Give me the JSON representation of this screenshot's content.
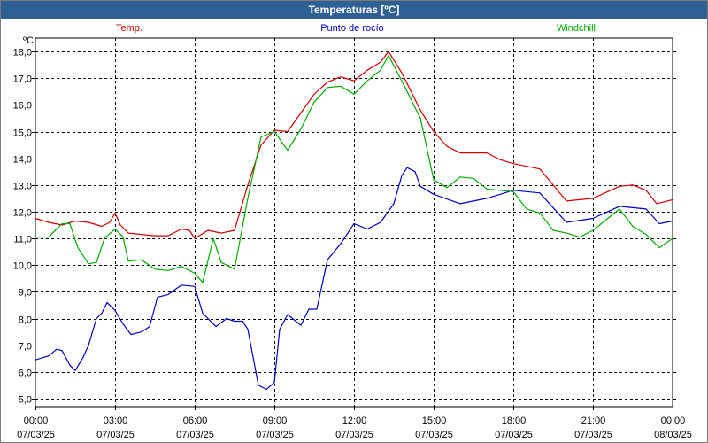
{
  "window": {
    "title": "Temperaturas [ºC]"
  },
  "chart_data": {
    "type": "line",
    "ylabel": "ºC",
    "ylim": [
      4.7,
      18.5
    ],
    "yticks": [
      "5,0",
      "6,0",
      "7,0",
      "8,0",
      "9,0",
      "10,0",
      "11,0",
      "12,0",
      "13,0",
      "14,0",
      "15,0",
      "16,0",
      "17,0",
      "18,0"
    ],
    "ytick_values": [
      5,
      6,
      7,
      8,
      9,
      10,
      11,
      12,
      13,
      14,
      15,
      16,
      17,
      18
    ],
    "xlim": [
      0,
      24
    ],
    "xticks": [
      {
        "x": 0,
        "time": "00:00",
        "date": "07/03/25"
      },
      {
        "x": 3,
        "time": "03:00",
        "date": "07/03/25"
      },
      {
        "x": 6,
        "time": "06:00",
        "date": "07/03/25"
      },
      {
        "x": 9,
        "time": "09:00",
        "date": "07/03/25"
      },
      {
        "x": 12,
        "time": "12:00",
        "date": "07/03/25"
      },
      {
        "x": 15,
        "time": "15:00",
        "date": "07/03/25"
      },
      {
        "x": 18,
        "time": "18:00",
        "date": "07/03/25"
      },
      {
        "x": 21,
        "time": "21:00",
        "date": "07/03/25"
      },
      {
        "x": 24,
        "time": "00:00",
        "date": "08/03/25"
      }
    ],
    "grid": true,
    "legend_position": "top",
    "series": [
      {
        "name": "Temp.",
        "color": "#cc0000",
        "points": [
          [
            0,
            11.75
          ],
          [
            0.5,
            11.6
          ],
          [
            1,
            11.5
          ],
          [
            1.5,
            11.65
          ],
          [
            2,
            11.6
          ],
          [
            2.5,
            11.45
          ],
          [
            2.8,
            11.6
          ],
          [
            3,
            11.95
          ],
          [
            3.2,
            11.5
          ],
          [
            3.5,
            11.2
          ],
          [
            4,
            11.15
          ],
          [
            4.5,
            11.1
          ],
          [
            5,
            11.1
          ],
          [
            5.5,
            11.35
          ],
          [
            5.8,
            11.3
          ],
          [
            6,
            11.0
          ],
          [
            6.5,
            11.3
          ],
          [
            7,
            11.2
          ],
          [
            7.5,
            11.3
          ],
          [
            8,
            13.0
          ],
          [
            8.5,
            14.5
          ],
          [
            9,
            15.05
          ],
          [
            9.5,
            15.0
          ],
          [
            10,
            15.7
          ],
          [
            10.5,
            16.4
          ],
          [
            11,
            16.85
          ],
          [
            11.5,
            17.05
          ],
          [
            12,
            16.9
          ],
          [
            12.5,
            17.3
          ],
          [
            13,
            17.6
          ],
          [
            13.3,
            18.0
          ],
          [
            13.8,
            17.2
          ],
          [
            14.5,
            15.8
          ],
          [
            15,
            15.0
          ],
          [
            15.5,
            14.45
          ],
          [
            16,
            14.2
          ],
          [
            17,
            14.2
          ],
          [
            17.5,
            13.95
          ],
          [
            18,
            13.8
          ],
          [
            19,
            13.6
          ],
          [
            19.5,
            13.0
          ],
          [
            20,
            12.4
          ],
          [
            21,
            12.5
          ],
          [
            22,
            12.95
          ],
          [
            22.5,
            13.0
          ],
          [
            23,
            12.8
          ],
          [
            23.4,
            12.3
          ],
          [
            24,
            12.45
          ]
        ]
      },
      {
        "name": "Punto de rocío",
        "color": "#0000bb",
        "points": [
          [
            0,
            6.45
          ],
          [
            0.5,
            6.6
          ],
          [
            0.8,
            6.85
          ],
          [
            1,
            6.8
          ],
          [
            1.3,
            6.25
          ],
          [
            1.5,
            6.05
          ],
          [
            1.8,
            6.55
          ],
          [
            2,
            7.0
          ],
          [
            2.3,
            8.0
          ],
          [
            2.5,
            8.2
          ],
          [
            2.7,
            8.6
          ],
          [
            3,
            8.3
          ],
          [
            3.3,
            7.8
          ],
          [
            3.6,
            7.4
          ],
          [
            4,
            7.5
          ],
          [
            4.3,
            7.7
          ],
          [
            4.6,
            8.8
          ],
          [
            5,
            8.9
          ],
          [
            5.5,
            9.25
          ],
          [
            6,
            9.2
          ],
          [
            6.3,
            8.2
          ],
          [
            6.8,
            7.7
          ],
          [
            7.2,
            8.0
          ],
          [
            7.5,
            7.9
          ],
          [
            7.8,
            7.9
          ],
          [
            8,
            7.6
          ],
          [
            8.4,
            5.5
          ],
          [
            8.7,
            5.35
          ],
          [
            9,
            5.6
          ],
          [
            9.2,
            7.6
          ],
          [
            9.5,
            8.15
          ],
          [
            10,
            7.75
          ],
          [
            10.3,
            8.35
          ],
          [
            10.6,
            8.35
          ],
          [
            11,
            10.2
          ],
          [
            11.5,
            10.8
          ],
          [
            12,
            11.55
          ],
          [
            12.5,
            11.35
          ],
          [
            13,
            11.6
          ],
          [
            13.5,
            12.3
          ],
          [
            13.8,
            13.35
          ],
          [
            14,
            13.65
          ],
          [
            14.3,
            13.5
          ],
          [
            14.5,
            12.95
          ],
          [
            15,
            12.65
          ],
          [
            16,
            12.3
          ],
          [
            17,
            12.5
          ],
          [
            18,
            12.8
          ],
          [
            19,
            12.7
          ],
          [
            20,
            11.6
          ],
          [
            21,
            11.75
          ],
          [
            22,
            12.2
          ],
          [
            23,
            12.1
          ],
          [
            23.5,
            11.55
          ],
          [
            24,
            11.65
          ]
        ]
      },
      {
        "name": "Windchill",
        "color": "#00aa00",
        "points": [
          [
            0,
            11.05
          ],
          [
            0.5,
            11.05
          ],
          [
            1,
            11.55
          ],
          [
            1.3,
            11.55
          ],
          [
            1.6,
            10.65
          ],
          [
            2,
            10.05
          ],
          [
            2.3,
            10.1
          ],
          [
            2.6,
            11.0
          ],
          [
            3,
            11.35
          ],
          [
            3.3,
            11.05
          ],
          [
            3.5,
            10.15
          ],
          [
            4,
            10.2
          ],
          [
            4.5,
            9.85
          ],
          [
            5,
            9.8
          ],
          [
            5.5,
            9.95
          ],
          [
            6,
            9.7
          ],
          [
            6.3,
            9.35
          ],
          [
            6.7,
            11.0
          ],
          [
            7,
            10.1
          ],
          [
            7.5,
            9.85
          ],
          [
            8,
            12.5
          ],
          [
            8.5,
            14.8
          ],
          [
            9,
            15.0
          ],
          [
            9.5,
            14.3
          ],
          [
            10,
            15.1
          ],
          [
            10.5,
            16.1
          ],
          [
            11,
            16.65
          ],
          [
            11.5,
            16.7
          ],
          [
            12,
            16.4
          ],
          [
            12.5,
            16.9
          ],
          [
            13,
            17.3
          ],
          [
            13.3,
            17.85
          ],
          [
            13.8,
            16.9
          ],
          [
            14.5,
            15.5
          ],
          [
            15,
            13.2
          ],
          [
            15.5,
            12.9
          ],
          [
            16,
            13.3
          ],
          [
            16.5,
            13.25
          ],
          [
            17,
            12.85
          ],
          [
            17.5,
            12.8
          ],
          [
            18,
            12.75
          ],
          [
            18.5,
            12.1
          ],
          [
            19,
            11.95
          ],
          [
            19.5,
            11.3
          ],
          [
            20,
            11.2
          ],
          [
            20.5,
            11.05
          ],
          [
            21,
            11.3
          ],
          [
            22,
            12.1
          ],
          [
            22.5,
            11.45
          ],
          [
            23,
            11.15
          ],
          [
            23.5,
            10.65
          ],
          [
            24,
            11.0
          ]
        ]
      }
    ]
  }
}
